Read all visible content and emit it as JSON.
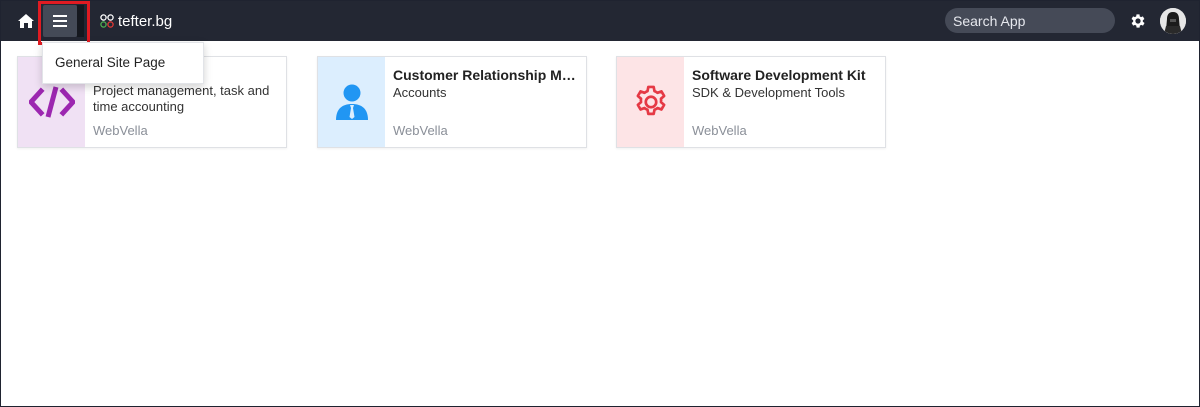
{
  "header": {
    "brand_name": "tefter.bg",
    "search_placeholder": "Search App"
  },
  "menu": {
    "items": [
      {
        "label": "General Site Page"
      }
    ]
  },
  "apps": [
    {
      "title": "",
      "description": "Project management, task and time accounting",
      "vendor": "WebVella",
      "icon": "code-icon",
      "tile_color": "#f0e1f4",
      "icon_color": "#9c27b0"
    },
    {
      "title": "Customer Relationship Ma...",
      "description": "Accounts",
      "vendor": "WebVella",
      "icon": "user-icon",
      "tile_color": "#dceefe",
      "icon_color": "#2196f3"
    },
    {
      "title": "Software Development Kit",
      "description": "SDK & Development Tools",
      "vendor": "WebVella",
      "icon": "gear-icon",
      "tile_color": "#fde4e6",
      "icon_color": "#e53945"
    }
  ],
  "colors": {
    "topbar": "#232733",
    "highlight": "#e01b22"
  }
}
